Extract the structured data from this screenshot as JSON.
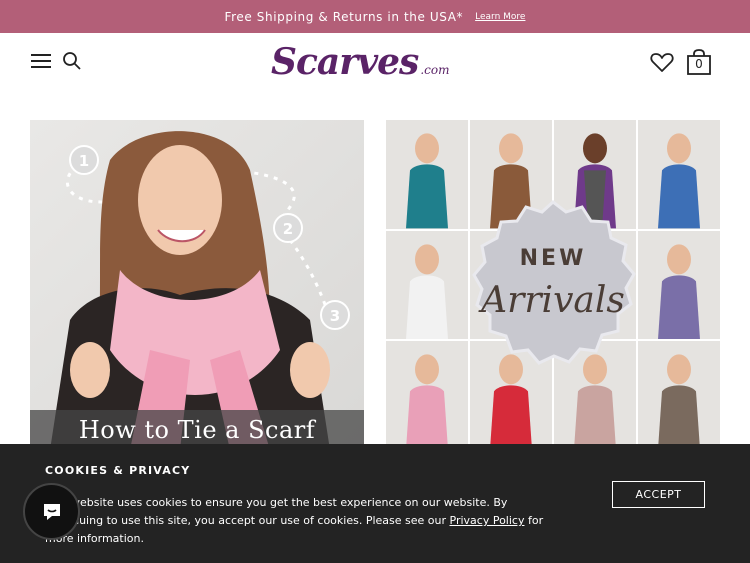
{
  "promo": {
    "text": "Free Shipping & Returns in the USA*",
    "link": "Learn More"
  },
  "header": {
    "logo_main": "Scarves",
    "logo_suffix": ".com",
    "menu_icon": "hamburger-icon",
    "search_icon": "search-icon",
    "wishlist_icon": "heart-icon",
    "cart_icon": "bag-icon",
    "cart_count": "0"
  },
  "tiles": {
    "left": {
      "banner": "How to Tie a Scarf",
      "steps": [
        "1",
        "2",
        "3"
      ]
    },
    "right": {
      "badge_top": "NEW",
      "badge_main": "Arrivals"
    }
  },
  "cookie": {
    "title": "COOKIES & PRIVACY",
    "body_before": "This website uses cookies to ensure you get the best experience on our website. By continuing to use this site, you accept our use of cookies. Please see our ",
    "privacy_link": "Privacy Policy",
    "body_after": " for more information.",
    "accept": "ACCEPT"
  },
  "colors": {
    "promo_bg": "#b35f78",
    "brand_purple": "#5a2367",
    "cookie_bg": "#232323"
  }
}
